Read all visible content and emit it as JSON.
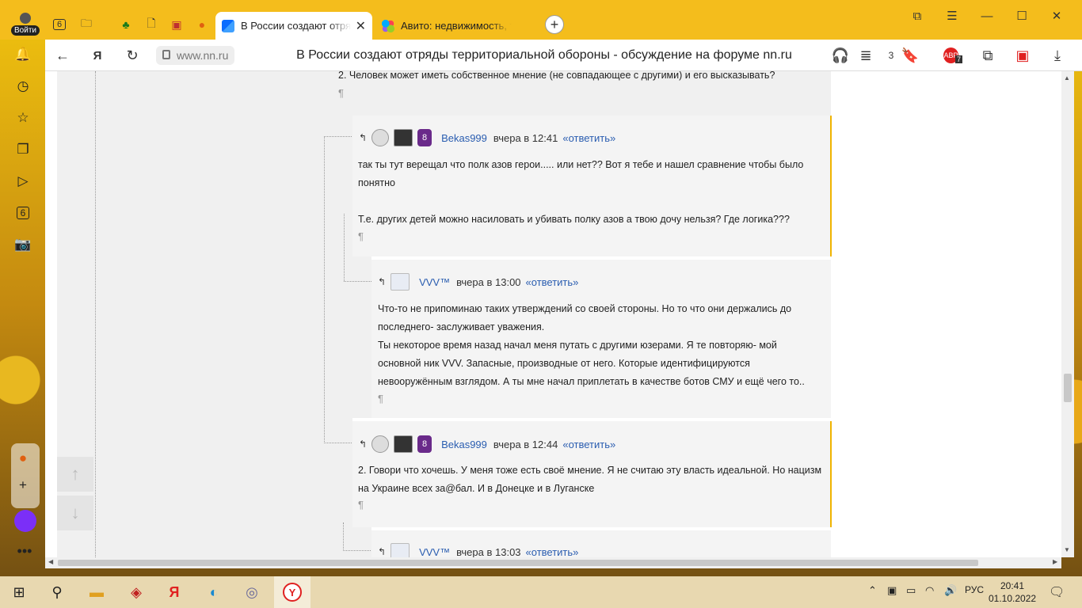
{
  "browser": {
    "login_label": "Войти",
    "tab_count": "6",
    "tabs": [
      {
        "title": "В России создают отряды территориальной обороны",
        "active": true
      },
      {
        "title": "Авито: недвижимость, транспорт",
        "active": false
      }
    ],
    "domain": "www.nn.ru",
    "page_title": "В России создают отряды территориальной обороны - обсуждение на форуме nn.ru",
    "badge_downloads": "3",
    "badge_adblock": "7",
    "sidebar_tabs_count": "6"
  },
  "forum": {
    "top_line": "2. Человек может иметь собственное мнение (не совпадающее с другими) и его высказывать?",
    "pilcrow": "¶",
    "reply_label": "«ответить»",
    "arrow": "↰",
    "posts": [
      {
        "author": "Bekas999",
        "time": "вчера в 12:41",
        "lines": [
          "так ты тут верещал что полк азов герои..... или нет?? Вот я тебе и нашел сравнение чтобы было",
          "понятно",
          "",
          "Т.е. других детей можно насиловать и убивать полку азов а твою дочу нельзя? Где логика???"
        ]
      },
      {
        "author": "VVV™",
        "time": "вчера в 13:00",
        "lines": [
          "Что-то не припоминаю таких утверждений со своей стороны. Но то что они держались до",
          "последнего- заслуживает уважения.",
          "Ты некоторое время назад начал меня путать с другими юзерами. Я те повторяю- мой",
          "основной ник VVV. Запасные, производные от него. Которые идентифицируются",
          "невооружённым взглядом. А ты мне начал приплетать в качестве ботов СМУ и ещё чего то.."
        ]
      },
      {
        "author": "Bekas999",
        "time": "вчера в 12:44",
        "lines": [
          "2. Говори что хочешь. У меня тоже есть своё мнение. Я не считаю эту власть идеальной. Но нацизм",
          "на Украине всех за@бал. И в Донецке и в Луганске"
        ]
      },
      {
        "author": "VVV™",
        "time": "вчера в 13:03",
        "lines": []
      }
    ],
    "badge_8": "8"
  },
  "taskbar": {
    "lang": "РУС",
    "time": "20:41",
    "date": "01.10.2022"
  }
}
